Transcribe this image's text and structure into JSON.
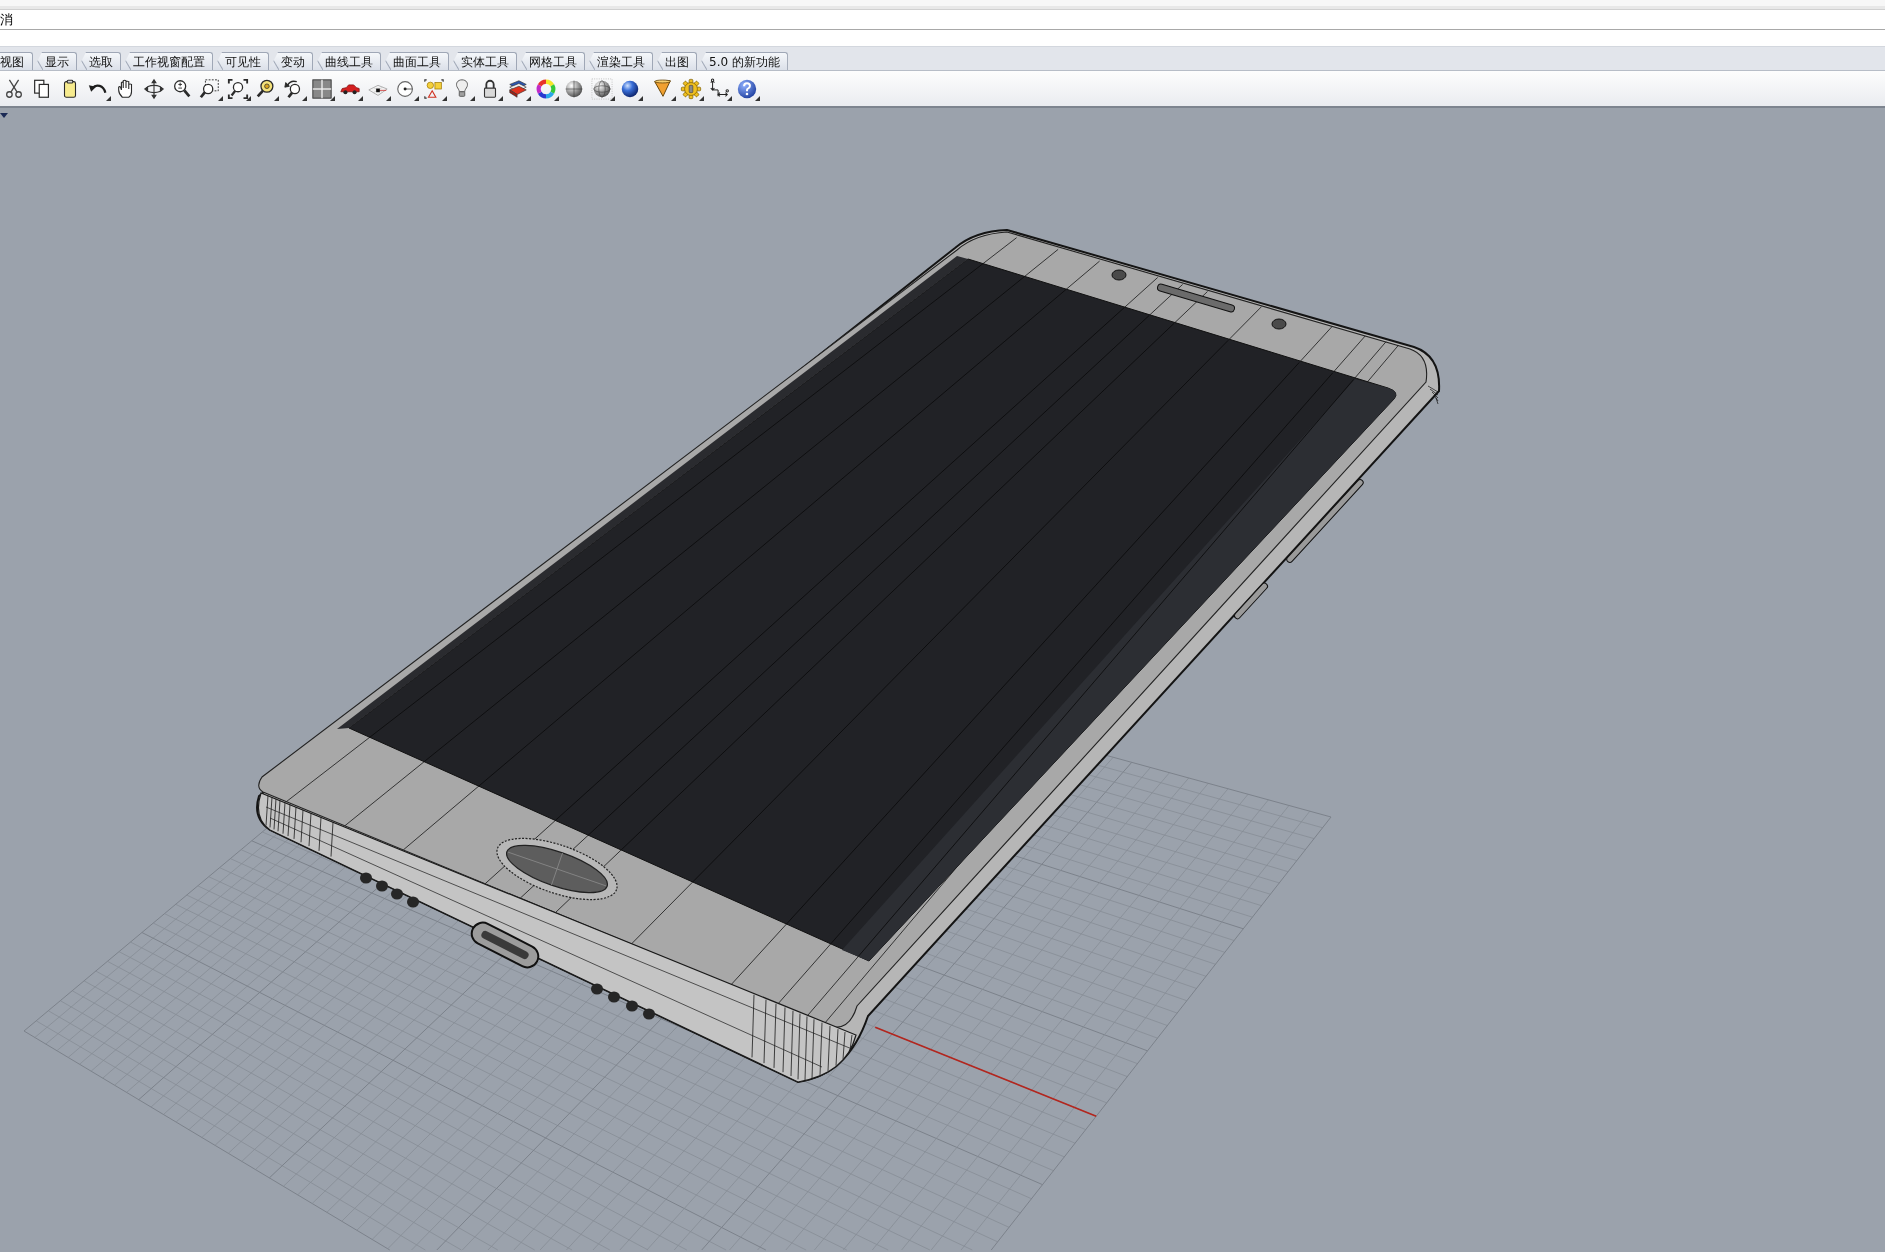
{
  "command_line": {
    "history": "消"
  },
  "toolbar_tabs": [
    {
      "label": "视图"
    },
    {
      "label": "显示"
    },
    {
      "label": "选取"
    },
    {
      "label": "工作视窗配置"
    },
    {
      "label": "可见性"
    },
    {
      "label": "变动"
    },
    {
      "label": "曲线工具"
    },
    {
      "label": "曲面工具"
    },
    {
      "label": "实体工具"
    },
    {
      "label": "网格工具"
    },
    {
      "label": "渲染工具"
    },
    {
      "label": "出图"
    },
    {
      "label": "5.0 的新功能"
    }
  ]
}
